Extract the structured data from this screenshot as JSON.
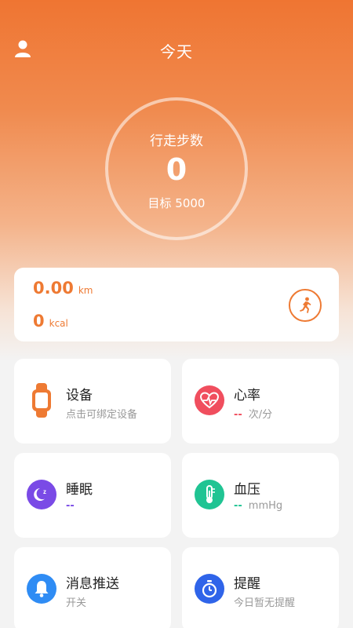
{
  "header": {
    "title": "今天",
    "user_icon": "user-icon"
  },
  "steps": {
    "label": "行走步数",
    "value": "0",
    "goal": "目标 5000"
  },
  "summary": {
    "distance_value": "0.00",
    "distance_unit": "km",
    "calorie_value": "0",
    "calorie_unit": "kcal",
    "run_icon": "running-icon"
  },
  "colors": {
    "accent": "#ee7a33",
    "heart": "#f04e5e",
    "sleep": "#7a4ae6",
    "pressure": "#20c493",
    "notify": "#2f8cf4",
    "reminder": "#2f64e9"
  },
  "cards": {
    "device": {
      "title": "设备",
      "sub": "点击可绑定设备",
      "icon": "watch-icon"
    },
    "heart": {
      "title": "心率",
      "dash": "--",
      "sub": "次/分",
      "icon": "heart-rate-icon"
    },
    "sleep": {
      "title": "睡眠",
      "dash": "--",
      "icon": "moon-icon"
    },
    "pressure": {
      "title": "血压",
      "dash": "--",
      "sub": "mmHg",
      "icon": "thermometer-icon"
    },
    "notify": {
      "title": "消息推送",
      "sub": "开关",
      "icon": "bell-icon"
    },
    "reminder": {
      "title": "提醒",
      "sub": "今日暂无提醒",
      "icon": "stopwatch-icon"
    }
  }
}
